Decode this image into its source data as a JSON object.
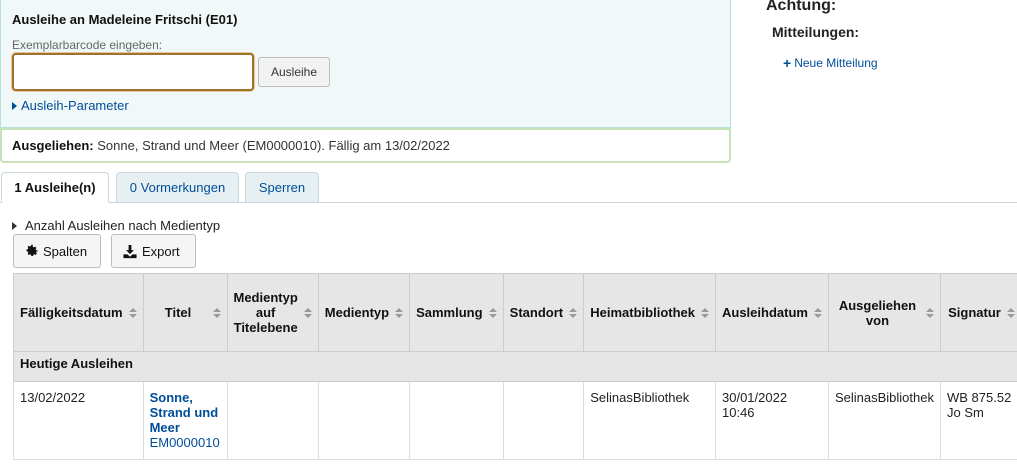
{
  "checkout": {
    "title": "Ausleihe an Madeleine Fritschi (E01)",
    "barcode_label": "Exemplarbarcode eingeben:",
    "barcode_value": "",
    "submit_label": "Ausleihe",
    "params_link": "Ausleih-Parameter"
  },
  "last_checkout": {
    "label": "Ausgeliehen:",
    "text": "Sonne, Strand und Meer (EM0000010). Fällig am 13/02/2022"
  },
  "attention": {
    "title": "Achtung:",
    "messages_title": "Mitteilungen:",
    "new_message": "Neue Mitteilung"
  },
  "tabs": [
    {
      "label": "1 Ausleihe(n)",
      "active": true
    },
    {
      "label": "0 Vormerkungen",
      "active": false
    },
    {
      "label": "Sperren",
      "active": false
    }
  ],
  "itemtype_summary": "Anzahl Ausleihen nach Medientyp",
  "toolbar": {
    "columns_label": "Spalten",
    "export_label": "Export"
  },
  "table": {
    "headers": {
      "due": "Fälligkeitsdatum",
      "title": "Titel",
      "biblio_itemtype": "Medientyp auf Titelebene",
      "itemtype": "Medientyp",
      "collection": "Sammlung",
      "location": "Standort",
      "homebranch": "Heimatbibliothek",
      "checkout_date": "Ausleihdatum",
      "checked_out_from": "Ausgeliehen von",
      "callnumber": "Signatur"
    },
    "group_label": "Heutige Ausleihen",
    "rows": [
      {
        "due": "13/02/2022",
        "title": "Sonne, Strand und Meer",
        "barcode": "EM0000010",
        "biblio_itemtype": "",
        "itemtype": "",
        "collection": "",
        "location": "",
        "homebranch": "SelinasBibliothek",
        "checkout_date": "30/01/2022",
        "checkout_time": "10:46",
        "checked_out_from": "SelinasBibliothek",
        "callnumber": "WB 875.52 Jo Sm"
      }
    ]
  },
  "colors": {
    "panel_bg": "#f1f8f8",
    "link": "#004d99",
    "last_checkout_border": "#c5e3b6",
    "input_focus": "#a0722a"
  },
  "icons": {
    "columns": "gear-icon",
    "export": "download-icon",
    "new_message": "plus-icon",
    "expand": "caret-right-icon",
    "sort": "sort-icon"
  }
}
